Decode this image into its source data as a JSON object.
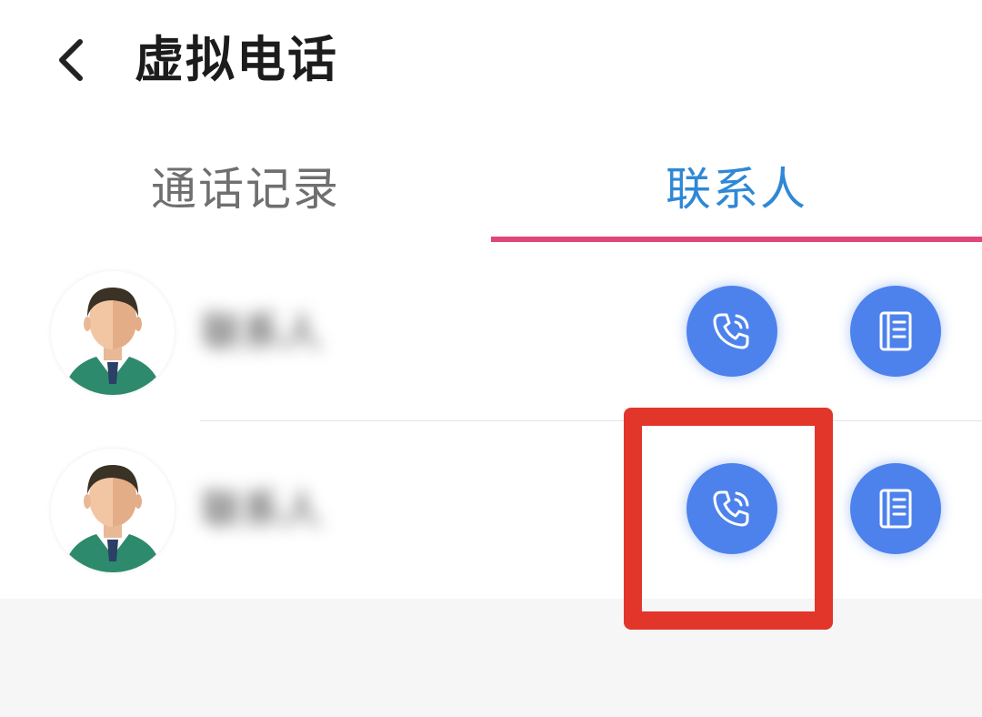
{
  "header": {
    "title": "虚拟电话",
    "back_icon": "chevron-left-icon"
  },
  "tabs": [
    {
      "label": "通话记录",
      "active": false
    },
    {
      "label": "联系人",
      "active": true
    }
  ],
  "contacts": [
    {
      "name": "联系人",
      "avatar_icon": "person-avatar-icon",
      "call_icon": "phone-call-icon",
      "notes_icon": "notebook-icon"
    },
    {
      "name": "联系人",
      "avatar_icon": "person-avatar-icon",
      "call_icon": "phone-call-icon",
      "notes_icon": "notebook-icon"
    }
  ],
  "colors": {
    "active_tab": "#2f88d6",
    "inactive_tab": "#6f6f6f",
    "tab_indicator": "#e0457b",
    "action_button": "#4d82ec",
    "highlight": "#e3362b"
  }
}
